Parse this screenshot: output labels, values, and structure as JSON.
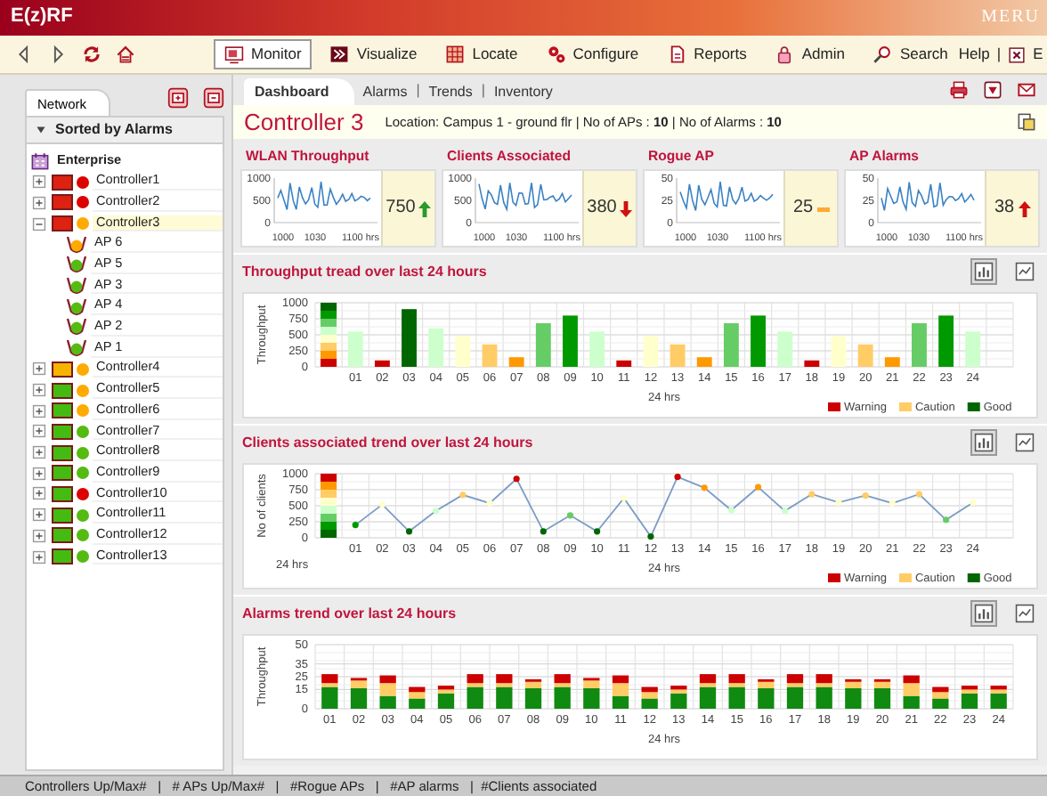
{
  "window": {
    "title": "E(z)RF",
    "logo": "MERU"
  },
  "toolbar": {
    "nav": [
      {
        "kind": "back"
      },
      {
        "kind": "forward"
      },
      {
        "kind": "refresh"
      },
      {
        "kind": "home"
      }
    ],
    "buttons": [
      {
        "label": "Monitor",
        "kind": "monitor",
        "selected": true
      },
      {
        "label": "Visualize",
        "kind": "visualize",
        "selected": false
      },
      {
        "label": "Locate",
        "kind": "locate",
        "selected": false
      },
      {
        "label": "Configure",
        "kind": "configure",
        "selected": false
      },
      {
        "label": "Reports",
        "kind": "reports",
        "selected": false
      },
      {
        "label": "Admin",
        "kind": "admin",
        "selected": false
      },
      {
        "label": "Search",
        "kind": "search",
        "selected": false
      }
    ],
    "help": "Help",
    "separator": "|",
    "exit_label": "E"
  },
  "sidebar": {
    "tabs": [
      {
        "label": "Network",
        "selected": true
      }
    ],
    "heading": "Sorted by Alarms",
    "tree": [
      {
        "label": "Enterprise",
        "kind": "enterprise",
        "selected": false,
        "children": [
          {
            "label": "Controller1",
            "kind": "controller",
            "color": "#dd0000",
            "icon": {
              "color": "#dd2211"
            },
            "expanded": false,
            "selected": false
          },
          {
            "label": "Controller2",
            "kind": "controller",
            "color": "#dd0000",
            "icon": {
              "color": "#dd2211"
            },
            "expanded": false,
            "selected": false
          },
          {
            "label": "Controller3",
            "kind": "controller",
            "color": "#ffaa00",
            "icon": {
              "color": "#dd2211"
            },
            "expanded": true,
            "selected": true,
            "children": [
              {
                "label": "AP 6",
                "kind": "ap",
                "color": "#ffaa00",
                "selected": false
              },
              {
                "label": "AP 5",
                "kind": "ap",
                "color": "#55bb11",
                "selected": false
              },
              {
                "label": "AP 3",
                "kind": "ap",
                "color": "#55bb11",
                "selected": false
              },
              {
                "label": "AP 4",
                "kind": "ap",
                "color": "#55bb11",
                "selected": false
              },
              {
                "label": "AP 2",
                "kind": "ap",
                "color": "#55bb11",
                "selected": false
              },
              {
                "label": "AP 1",
                "kind": "ap",
                "color": "#55bb11",
                "selected": false
              }
            ]
          },
          {
            "label": "Controller4",
            "kind": "controller",
            "color": "#ffaa00",
            "icon": {
              "color": "#f5b400"
            },
            "expanded": false,
            "selected": false
          },
          {
            "label": "Controller5",
            "kind": "controller",
            "color": "#ffaa00",
            "icon": {
              "color": "#44bb11"
            },
            "expanded": false,
            "selected": false
          },
          {
            "label": "Controller6",
            "kind": "controller",
            "color": "#ffaa00",
            "icon": {
              "color": "#44bb11"
            },
            "expanded": false,
            "selected": false
          },
          {
            "label": "Controller7",
            "kind": "controller",
            "color": "#55bb11",
            "icon": {
              "color": "#44bb11"
            },
            "expanded": false,
            "selected": false
          },
          {
            "label": "Controller8",
            "kind": "controller",
            "color": "#55bb11",
            "icon": {
              "color": "#44bb11"
            },
            "expanded": false,
            "selected": false
          },
          {
            "label": "Controller9",
            "kind": "controller",
            "color": "#55bb11",
            "icon": {
              "color": "#44bb11"
            },
            "expanded": false,
            "selected": false
          },
          {
            "label": "Controller10",
            "kind": "controller",
            "color": "#dd0000",
            "icon": {
              "color": "#44bb11"
            },
            "expanded": false,
            "selected": false
          },
          {
            "label": "Controller11",
            "kind": "controller",
            "color": "#55bb11",
            "icon": {
              "color": "#44bb11"
            },
            "expanded": false,
            "selected": false
          },
          {
            "label": "Controller12",
            "kind": "controller",
            "color": "#55bb11",
            "icon": {
              "color": "#44bb11"
            },
            "expanded": false,
            "selected": false
          },
          {
            "label": "Controller13",
            "kind": "controller",
            "color": "#55bb11",
            "icon": {
              "color": "#44bb11"
            },
            "expanded": false,
            "selected": false
          }
        ]
      }
    ]
  },
  "main": {
    "tabs": [
      {
        "label": "Dashboard",
        "selected": true
      },
      {
        "label": "Alarms",
        "selected": false
      },
      {
        "label": "Trends",
        "selected": false
      },
      {
        "label": "Inventory",
        "selected": false
      }
    ],
    "tab_separator": "|",
    "actions": [
      {
        "kind": "print"
      },
      {
        "kind": "download"
      },
      {
        "kind": "mail"
      }
    ],
    "title": "Controller 3",
    "info": "Location: Campus 1 - ground flr  |  No of APs : **10**  |  No of Alarms : **10**",
    "cards": [
      {
        "title": "WLAN Throughput",
        "y_ticks": [
          "1000",
          "500",
          "0"
        ],
        "x_ticks": [
          "1000",
          "1030",
          "1100 hrs"
        ],
        "value": "750",
        "kind": "up",
        "color": "#2a9a2a"
      },
      {
        "title": "Clients Associated",
        "y_ticks": [
          "1000",
          "500",
          "0"
        ],
        "x_ticks": [
          "1000",
          "1030",
          "1100 hrs"
        ],
        "value": "380",
        "kind": "down",
        "color": "#d01010"
      },
      {
        "title": "Rogue AP",
        "y_ticks": [
          "50",
          "25",
          "0"
        ],
        "x_ticks": [
          "1000",
          "1030",
          "1100 hrs"
        ],
        "value": "25",
        "kind": "flat",
        "color": "#ffaa33"
      },
      {
        "title": "AP Alarms",
        "y_ticks": [
          "50",
          "25",
          "0"
        ],
        "x_ticks": [
          "1000",
          "1030",
          "1100 hrs"
        ],
        "value": "38",
        "kind": "up",
        "color": "#d01010"
      }
    ],
    "charts": [
      {
        "title": "Throughput tread over last 24 hours",
        "toggles": [
          {
            "kind": "bar",
            "selected": true
          },
          {
            "kind": "line",
            "selected": false
          }
        ],
        "kind": "ascending",
        "legend": [
          {
            "label": "Warning",
            "color": "#cc0000"
          },
          {
            "label": "Caution",
            "color": "#ffcc66"
          },
          {
            "label": "Good",
            "color": "#006600"
          }
        ],
        "chart_data": {
          "type": "bar",
          "grid": true,
          "xlabel": "24 hrs",
          "ylabel": "Throughput",
          "categories": [
            "01",
            "02",
            "03",
            "04",
            "05",
            "06",
            "07",
            "08",
            "09",
            "10",
            "11",
            "12",
            "13",
            "14",
            "15",
            "16",
            "17",
            "18",
            "19",
            "20",
            "21",
            "22",
            "23",
            "24"
          ],
          "series": [
            {
              "values": [
                550,
                100,
                900,
                600,
                480,
                350,
                150,
                680,
                800,
                550,
                100,
                480,
                350,
                150,
                680,
                800,
                550,
                100,
                480,
                350,
                150,
                680,
                800,
                550
              ]
            }
          ],
          "ylim": [
            0,
            1000
          ],
          "yticks": [
            0,
            250,
            500,
            750,
            1000
          ]
        }
      },
      {
        "title": "Clients associated trend over last 24 hours",
        "toggles": [
          {
            "kind": "bar",
            "selected": true
          },
          {
            "kind": "line",
            "selected": false
          }
        ],
        "kind": "descending",
        "note": "24 hrs",
        "legend": [
          {
            "label": "Warning",
            "color": "#cc0000"
          },
          {
            "label": "Caution",
            "color": "#ffcc66"
          },
          {
            "label": "Good",
            "color": "#006600"
          }
        ],
        "chart_data": {
          "type": "line",
          "grid": true,
          "xlabel": "24 hrs",
          "ylabel": "No of clients",
          "categories": [
            "01",
            "02",
            "03",
            "04",
            "05",
            "06",
            "07",
            "08",
            "09",
            "10",
            "11",
            "12",
            "13",
            "14",
            "15",
            "16",
            "17",
            "18",
            "19",
            "20",
            "21",
            "22",
            "23",
            "24"
          ],
          "series": [
            {
              "marker": "circle",
              "values": [
                200,
                520,
                100,
                420,
                670,
                540,
                920,
                100,
                350,
                100,
                620,
                20,
                950,
                780,
                430,
                790,
                420,
                680,
                550,
                660,
                540,
                680,
                280,
                550
              ]
            }
          ],
          "ylim": [
            0,
            1000
          ],
          "yticks": [
            0,
            250,
            500,
            750,
            1000
          ]
        }
      },
      {
        "title": "Alarms trend over last 24 hours",
        "toggles": [
          {
            "kind": "bar",
            "selected": true
          },
          {
            "kind": "line",
            "selected": false
          }
        ],
        "kind": "plain",
        "chart_data": {
          "type": "bar",
          "stacked": true,
          "grid": true,
          "xlabel": "24 hrs",
          "ylabel": "Throughput",
          "categories": [
            "01",
            "02",
            "03",
            "04",
            "05",
            "06",
            "07",
            "08",
            "09",
            "10",
            "11",
            "12",
            "13",
            "14",
            "15",
            "16",
            "17",
            "18",
            "19",
            "20",
            "21",
            "22",
            "23",
            "24"
          ],
          "series": [
            {
              "color": "#108a10",
              "values": [
                17,
                16,
                10,
                8,
                12,
                17,
                17,
                16,
                17,
                16,
                10,
                8,
                12,
                17,
                17,
                16,
                17,
                17,
                16,
                16,
                10,
                8,
                12,
                12
              ]
            },
            {
              "color": "#ffcc66",
              "values": [
                3,
                6,
                10,
                5,
                3,
                3,
                3,
                5,
                3,
                6,
                10,
                5,
                3,
                3,
                3,
                5,
                3,
                3,
                5,
                5,
                10,
                5,
                3,
                3
              ]
            },
            {
              "color": "#cc0000",
              "values": [
                7,
                2,
                6,
                4,
                3,
                7,
                7,
                2,
                7,
                2,
                6,
                4,
                3,
                7,
                7,
                2,
                7,
                7,
                2,
                2,
                6,
                4,
                3,
                3
              ]
            }
          ],
          "ylim": [
            0,
            50
          ],
          "yticks": [
            0,
            15,
            25,
            35,
            50
          ]
        }
      }
    ]
  },
  "status_bar": "Controllers Up/Max#   |   # APs Up/Max#   |   #Rogue APs   |   #AP alarms   |  #Clients associated"
}
